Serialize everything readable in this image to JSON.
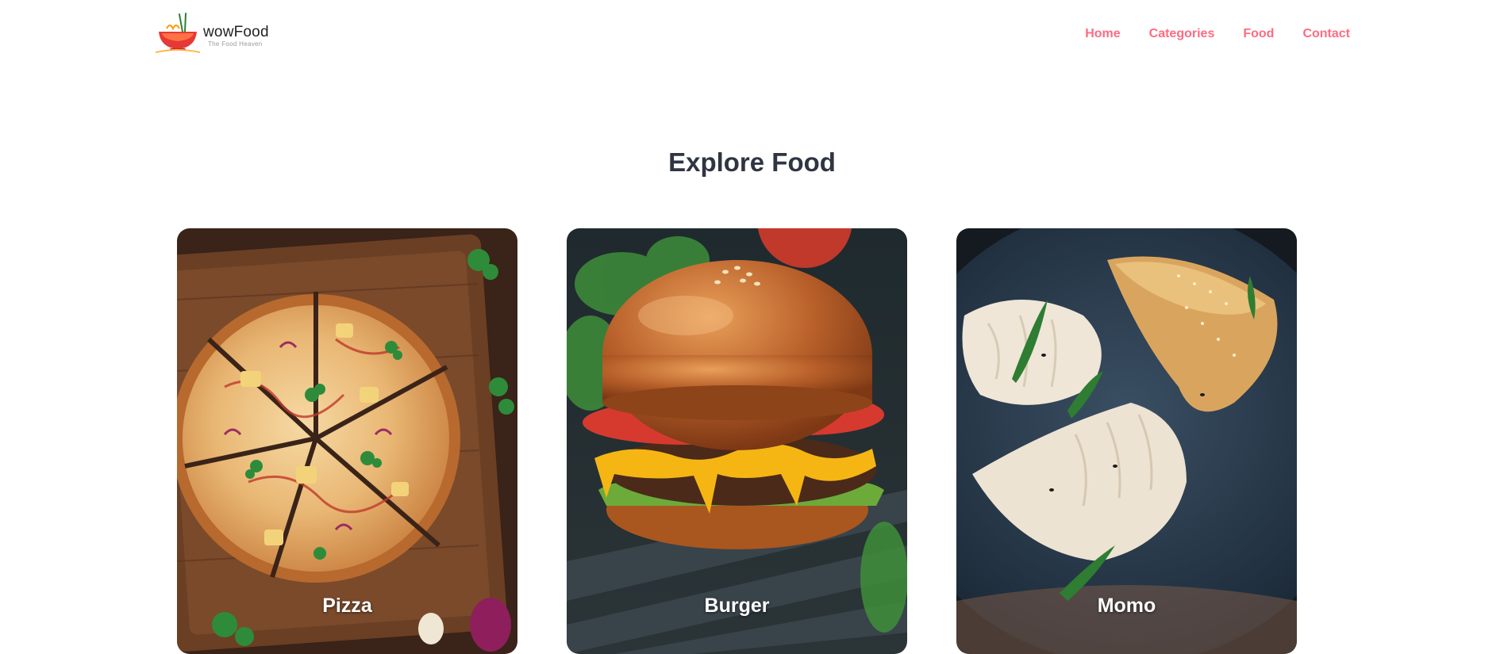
{
  "brand": {
    "name": "wowFood",
    "tagline": "The Food Heaven"
  },
  "nav": {
    "items": [
      {
        "label": "Home"
      },
      {
        "label": "Categories"
      },
      {
        "label": "Food"
      },
      {
        "label": "Contact"
      }
    ]
  },
  "explore": {
    "title": "Explore Food",
    "categories": [
      {
        "label": "Pizza",
        "icon": "pizza-photo"
      },
      {
        "label": "Burger",
        "icon": "burger-photo"
      },
      {
        "label": "Momo",
        "icon": "momo-photo"
      }
    ]
  },
  "colors": {
    "accent": "#ff6b81",
    "heading": "#2f3542",
    "background": "#ffffff"
  }
}
